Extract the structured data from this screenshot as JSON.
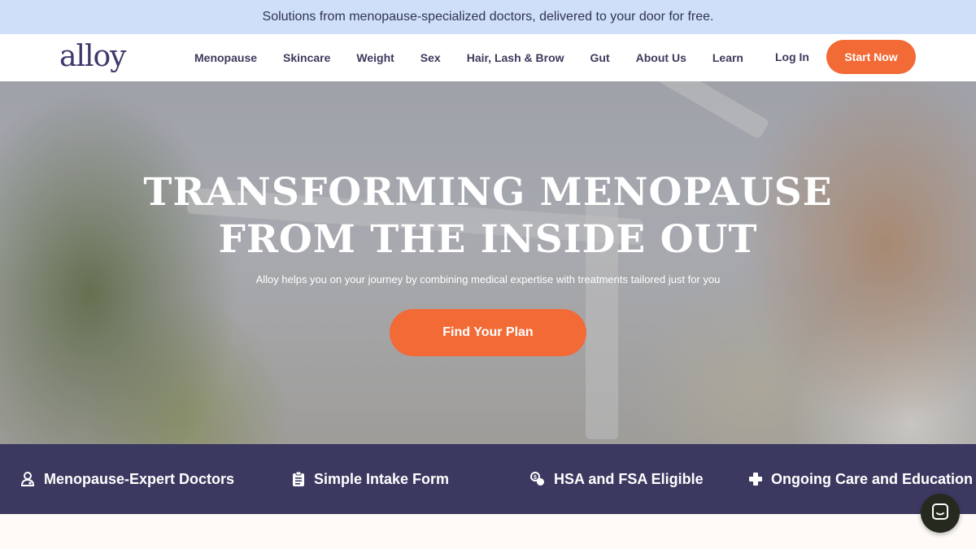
{
  "promo": {
    "text": "Solutions from menopause-specialized doctors, delivered to your door for free."
  },
  "header": {
    "logo": "alloy",
    "nav": [
      "Menopause",
      "Skincare",
      "Weight",
      "Sex",
      "Hair, Lash & Brow",
      "Gut",
      "About Us",
      "Learn"
    ],
    "login_label": "Log In",
    "start_label": "Start Now"
  },
  "hero": {
    "title": "TRANSFORMING MENOPAUSE FROM THE INSIDE OUT",
    "subtitle": "Alloy helps you on your journey by combining medical expertise with treatments tailored just for you",
    "cta_label": "Find Your Plan"
  },
  "features": [
    {
      "label": "Menopause-Expert Doctors",
      "icon": "doctor-icon"
    },
    {
      "label": "Simple Intake Form",
      "icon": "clipboard-icon"
    },
    {
      "label": "HSA and FSA Eligible",
      "icon": "coins-icon"
    },
    {
      "label": "Ongoing Care and Education",
      "icon": "plus-icon"
    }
  ],
  "colors": {
    "promo_bg": "#cfdffa",
    "accent": "#f26a36",
    "brand_dark": "#3c3961",
    "text_dark": "#3d3a5c",
    "chat_button": "#262a1e"
  }
}
